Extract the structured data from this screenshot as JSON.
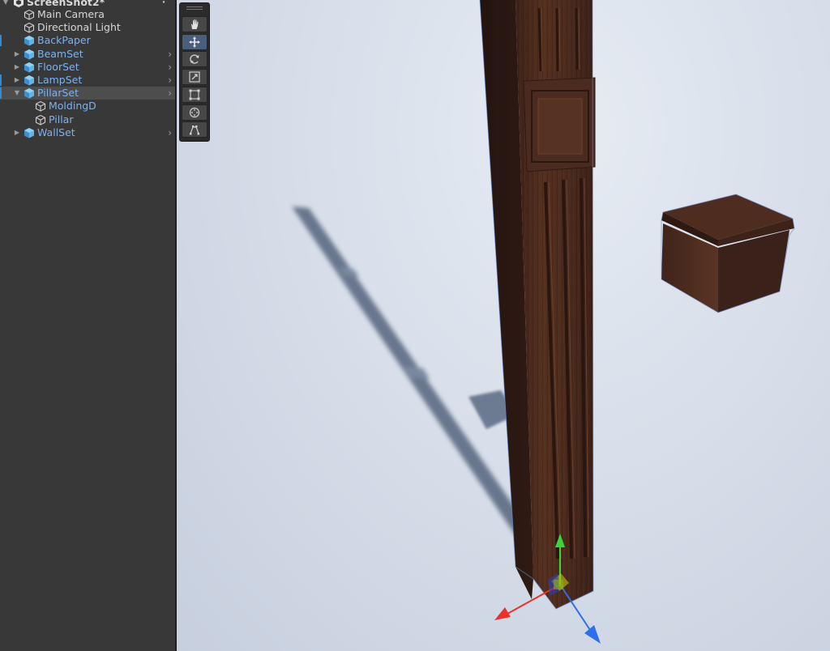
{
  "hierarchy": {
    "scene_name": "ScreenShot2*",
    "items": [
      {
        "label": "Main Camera",
        "color": "white",
        "icon": "gameobject-icon",
        "depth": 1,
        "expandable": false,
        "expanded": false
      },
      {
        "label": "Directional Light",
        "color": "white",
        "icon": "gameobject-icon",
        "depth": 1,
        "expandable": false,
        "expanded": false
      },
      {
        "label": "BackPaper",
        "color": "blue",
        "icon": "prefab-icon",
        "depth": 1,
        "expandable": false,
        "expanded": false,
        "modified": true
      },
      {
        "label": "BeamSet",
        "color": "blue",
        "icon": "prefab-icon",
        "depth": 1,
        "expandable": true,
        "expanded": false
      },
      {
        "label": "FloorSet",
        "color": "blue",
        "icon": "prefab-icon",
        "depth": 1,
        "expandable": true,
        "expanded": false
      },
      {
        "label": "LampSet",
        "color": "blue",
        "icon": "prefab-icon",
        "depth": 1,
        "expandable": true,
        "expanded": false,
        "modified": true
      },
      {
        "label": "PillarSet",
        "color": "blue",
        "icon": "prefab-icon",
        "depth": 1,
        "expandable": true,
        "expanded": true,
        "selected": true,
        "modified": true
      },
      {
        "label": "MoldingD",
        "color": "blue",
        "icon": "gameobject-icon",
        "depth": 2,
        "expandable": false,
        "expanded": false
      },
      {
        "label": "Pillar",
        "color": "blue",
        "icon": "gameobject-icon",
        "depth": 2,
        "expandable": false,
        "expanded": false
      },
      {
        "label": "WallSet",
        "color": "blue",
        "icon": "prefab-icon",
        "depth": 1,
        "expandable": true,
        "expanded": false
      }
    ]
  },
  "toolbar": {
    "tools": [
      {
        "name": "view-tool",
        "icon": "hand-icon",
        "active": false
      },
      {
        "name": "move-tool",
        "icon": "move-arrows-icon",
        "active": true
      },
      {
        "name": "rotate-tool",
        "icon": "rotate-icon",
        "active": false
      },
      {
        "name": "scale-tool",
        "icon": "scale-icon",
        "active": false
      },
      {
        "name": "rect-tool",
        "icon": "rect-icon",
        "active": false
      },
      {
        "name": "transform-tool",
        "icon": "transform-icon",
        "active": false
      },
      {
        "name": "custom-tool",
        "icon": "custom-editor-icon",
        "active": false
      }
    ]
  },
  "colors": {
    "panel_bg": "#383838",
    "selected_row": "#4d4d4d",
    "prefab_text": "#7cb1f0",
    "prefab_icon": "#5fb4e8",
    "modified_marker": "#2f8ad8",
    "gizmo_x": "#e8322a",
    "gizmo_y": "#3cd43c",
    "gizmo_z": "#2f6fe8",
    "wood_dark": "#3a2018",
    "wood_mid": "#4e2c20",
    "shadow": "#55657e"
  }
}
